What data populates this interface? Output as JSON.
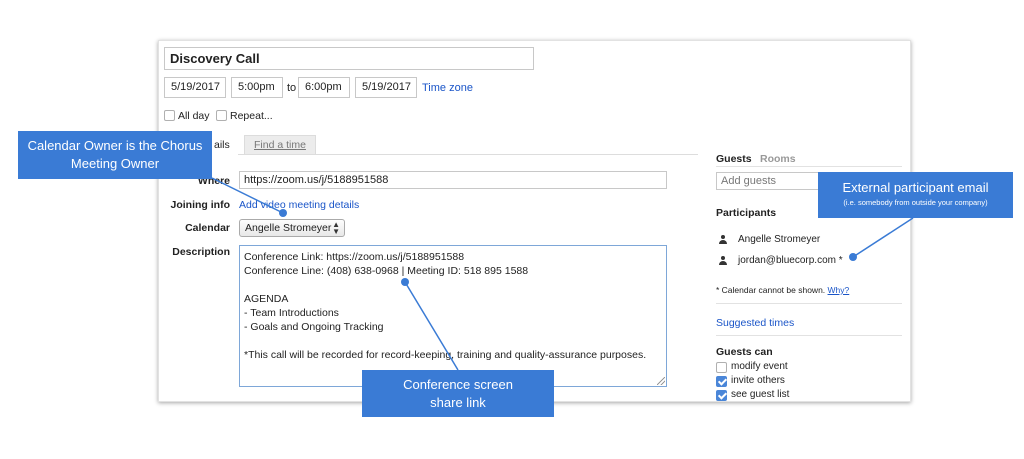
{
  "event": {
    "title": "Discovery Call",
    "start_date": "5/19/2017",
    "start_time": "5:00pm",
    "to_label": "to",
    "end_time": "6:00pm",
    "end_date": "5/19/2017",
    "timezone_link": "Time zone",
    "allday_label": "All day",
    "repeat_label": "Repeat..."
  },
  "tabs": {
    "details_partial": "ails",
    "find_time": "Find a time"
  },
  "fields": {
    "where_label": "Where",
    "where_value": "https://zoom.us/j/5188951588",
    "joining_label": "Joining info",
    "joining_link": "Add video meeting details",
    "calendar_label": "Calendar",
    "calendar_value": "Angelle Stromeyer",
    "description_label": "Description"
  },
  "description_lines": [
    "Conference Link: https://zoom.us/j/5188951588",
    "Conference Line: (408) 638-0968 | Meeting ID: 518 895 1588",
    "",
    "AGENDA",
    "- Team Introductions",
    "- Goals and Ongoing Tracking",
    "",
    "*This call will be recorded for record-keeping, training and quality-assurance purposes."
  ],
  "guests": {
    "guests_tab": "Guests",
    "rooms_tab": "Rooms",
    "add_placeholder": "Add guests",
    "participants_label": "Participants",
    "participants": [
      "Angelle Stromeyer",
      "jordan@bluecorp.com *"
    ],
    "cannot_show": "* Calendar cannot be shown.",
    "why_link": "Why?",
    "suggested_times": "Suggested times",
    "guests_can_label": "Guests can",
    "permissions": [
      {
        "label": "modify event",
        "checked": false
      },
      {
        "label": "invite others",
        "checked": true
      },
      {
        "label": "see guest list",
        "checked": true
      }
    ]
  },
  "callouts": {
    "owner": "Calendar Owner is the Chorus Meeting Owner",
    "external": "External participant email",
    "external_sub": "(i.e. somebody from outside your company)",
    "screen_share": "Conference screen share link"
  },
  "colors": {
    "accent": "#3a7bd5",
    "link": "#1a55c8"
  }
}
